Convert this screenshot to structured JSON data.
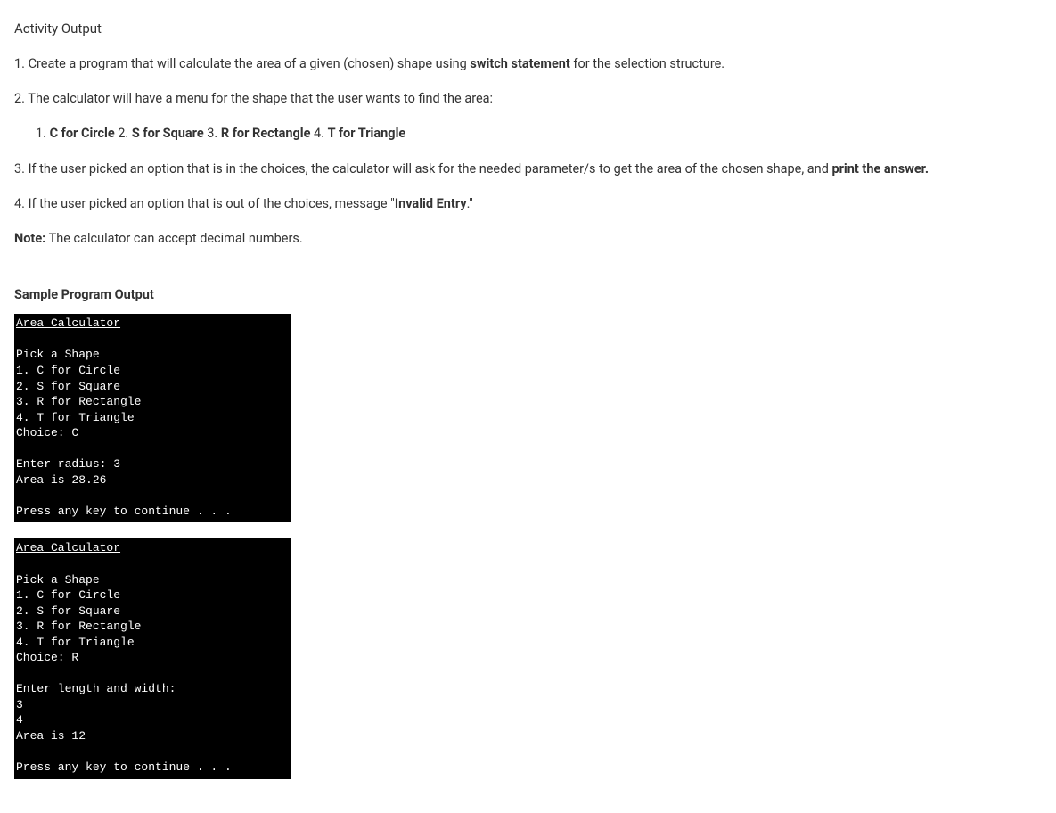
{
  "heading": "Activity Output",
  "instructions": {
    "line1_prefix": "1. Create a program that will calculate the area of a given (chosen) shape using ",
    "line1_bold": "switch statement",
    "line1_suffix": " for the selection structure.",
    "line2": "2. The calculator will have a menu for the shape that the user wants to find the area:",
    "sublist": {
      "p1_num": "1. ",
      "p1_bold": "C for Circle",
      "p2_num": "  2. ",
      "p2_bold": "S for Square",
      "p3_num": "  3. ",
      "p3_bold": "R for Rectangle",
      "p4_num": "  4. ",
      "p4_bold": "T for Triangle"
    },
    "line3_prefix": "3. If the user picked an option that is in the choices, the calculator will ask for the needed parameter/s to get the area of the chosen shape, and ",
    "line3_bold": "print the answer.",
    "line4_prefix": "4. If the user picked an option that is out of the choices, message \"",
    "line4_bold": "Invalid Entry",
    "line4_suffix": ".\"",
    "note_bold": "Note:",
    "note_text": " The calculator can accept decimal numbers."
  },
  "sample_heading": "Sample Program Output",
  "console1": {
    "title": "Area Calculator",
    "body": "Pick a Shape\n1. C for Circle\n2. S for Square\n3. R for Rectangle\n4. T for Triangle\nChoice: C\n\nEnter radius: 3\nArea is 28.26\n\nPress any key to continue . . ."
  },
  "console2": {
    "title": "Area Calculator",
    "body": "Pick a Shape\n1. C for Circle\n2. S for Square\n3. R for Rectangle\n4. T for Triangle\nChoice: R\n\nEnter length and width:\n3\n4\nArea is 12\n\nPress any key to continue . . ."
  }
}
